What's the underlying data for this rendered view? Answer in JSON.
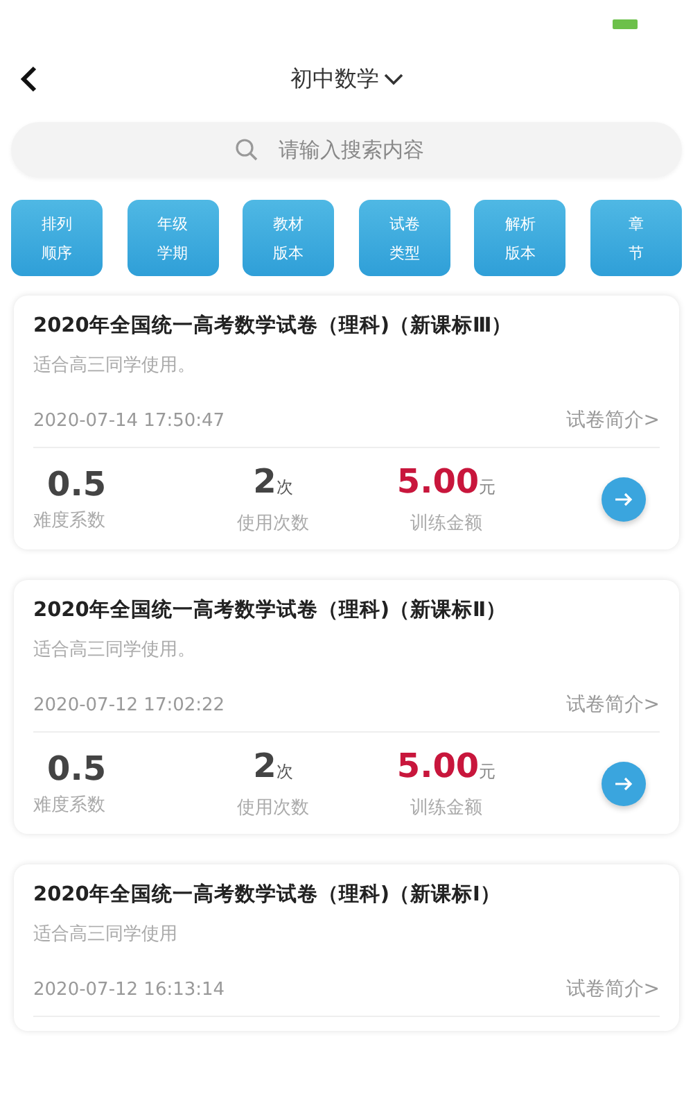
{
  "header": {
    "title": "初中数学"
  },
  "search": {
    "placeholder": "请输入搜索内容"
  },
  "filters": [
    {
      "line1": "排列",
      "line2": "顺序"
    },
    {
      "line1": "年级",
      "line2": "学期"
    },
    {
      "line1": "教材",
      "line2": "版本"
    },
    {
      "line1": "试卷",
      "line2": "类型"
    },
    {
      "line1": "解析",
      "line2": "版本"
    },
    {
      "line1": "章",
      "line2": "节"
    }
  ],
  "papers": [
    {
      "title": "2020年全国统一高考数学试卷（理科)（新课标Ⅲ）",
      "desc": "适合高三同学使用。",
      "date": "2020-07-14 17:50:47",
      "intro": "试卷简介>",
      "stats": {
        "difficulty": "0.5",
        "difficulty_label": "难度系数",
        "uses": "2",
        "uses_unit": "次",
        "uses_label": "使用次数",
        "price": "5.00",
        "price_unit": "元",
        "price_label": "训练金额"
      }
    },
    {
      "title": "2020年全国统一高考数学试卷（理科)（新课标Ⅱ）",
      "desc": "适合高三同学使用。",
      "date": "2020-07-12 17:02:22",
      "intro": "试卷简介>",
      "stats": {
        "difficulty": "0.5",
        "difficulty_label": "难度系数",
        "uses": "2",
        "uses_unit": "次",
        "uses_label": "使用次数",
        "price": "5.00",
        "price_unit": "元",
        "price_label": "训练金额"
      }
    },
    {
      "title": "2020年全国统一高考数学试卷（理科)（新课标Ⅰ）",
      "desc": "适合高三同学使用",
      "date": "2020-07-12 16:13:14",
      "intro": "试卷简介>"
    }
  ]
}
